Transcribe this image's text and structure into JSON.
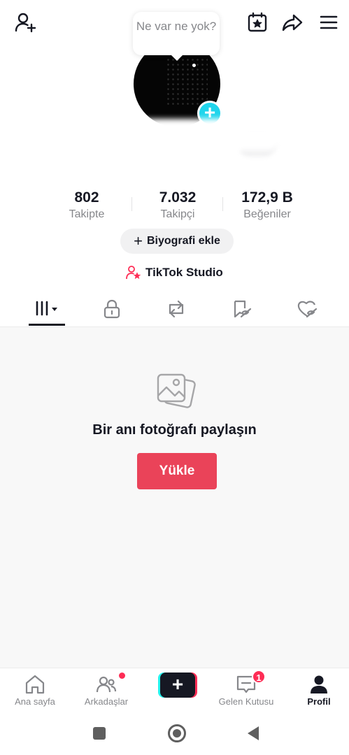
{
  "header": {
    "status_bubble": "Ne var ne yok?"
  },
  "stats": [
    {
      "value": "802",
      "label": "Takipte"
    },
    {
      "value": "7.032",
      "label": "Takipçi"
    },
    {
      "value": "172,9 B",
      "label": "Beğeniler"
    }
  ],
  "profile": {
    "bio_button": "Biyografi ekle",
    "bio_plus": "+",
    "studio_label": "TikTok Studio"
  },
  "tabs": [
    "videos-tab",
    "private-tab",
    "reposts-tab",
    "favorites-tab",
    "liked-tab"
  ],
  "content": {
    "empty_title": "Bir anı fotoğrafı paylaşın",
    "upload_button": "Yükle"
  },
  "bottom_nav": {
    "items": [
      {
        "label": "Ana sayfa",
        "icon": "home-icon"
      },
      {
        "label": "Arkadaşlar",
        "icon": "friends-icon"
      },
      {
        "label": "+",
        "icon": "create-icon"
      },
      {
        "label": "Gelen Kutusu",
        "icon": "inbox-icon"
      },
      {
        "label": "Profil",
        "icon": "profile-icon"
      }
    ],
    "inbox_badge": "1"
  },
  "colors": {
    "accent": "#ea4359",
    "badge": "#fe2c55",
    "avatar_add": "#20d5ec"
  }
}
